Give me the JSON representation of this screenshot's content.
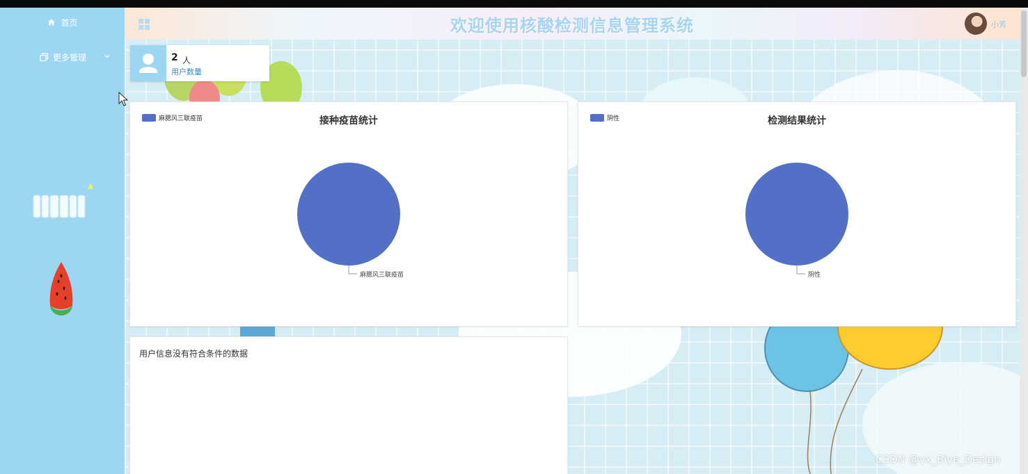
{
  "header": {
    "title": "欢迎使用核酸检测信息管理系统",
    "username": "小芳"
  },
  "sidebar": {
    "items": [
      {
        "label": "首页",
        "icon": "home-icon"
      },
      {
        "label": "更多管理",
        "icon": "copy-icon"
      }
    ]
  },
  "stat": {
    "count": "2",
    "unit": "人",
    "label": "用户数量"
  },
  "charts": {
    "vaccine": {
      "title": "接种疫苗统计",
      "legend": "麻腮风三联疫苗",
      "slice_label": "麻腮风三联疫苗",
      "color": "#5470c6"
    },
    "test_result": {
      "title": "检测结果统计",
      "legend": "阴性",
      "slice_label": "阴性",
      "color": "#5470c6"
    }
  },
  "chart_data": [
    {
      "type": "pie",
      "title": "接种疫苗统计",
      "categories": [
        "麻腮风三联疫苗"
      ],
      "values": [
        1
      ],
      "legend": "top-left"
    },
    {
      "type": "pie",
      "title": "检测结果统计",
      "categories": [
        "阴性"
      ],
      "values": [
        1
      ],
      "legend": "top-left"
    }
  ],
  "user_table": {
    "empty_message": "用户信息没有符合条件的数据"
  },
  "watermark": "CSDN @vx_Biye_Design",
  "colors": {
    "sidebar": "#9dd6f3",
    "accent": "#2e8bd0",
    "series": "#5470c6"
  }
}
